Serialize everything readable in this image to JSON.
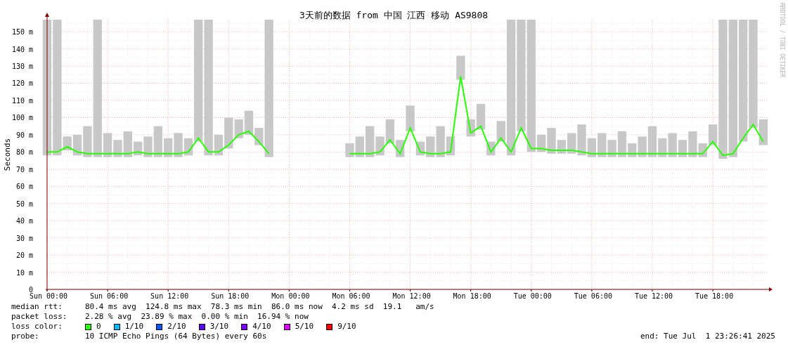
{
  "chart": {
    "credit": "RRDTOOL / TOBI OETIKER",
    "chart_data": {
      "type": "line",
      "grid": true,
      "title": "3天前的数据 from 中国 江西 移动 AS9808",
      "ylabel": "Seconds",
      "ylim": [
        0,
        157
      ],
      "categories": [
        "Sun 00:00",
        null,
        null,
        null,
        null,
        null,
        "Sun 06:00",
        null,
        null,
        null,
        null,
        null,
        "Sun 12:00",
        null,
        null,
        null,
        null,
        null,
        "Sun 18:00",
        null,
        null,
        null,
        null,
        null,
        "Mon 00:00",
        null,
        null,
        null,
        null,
        null,
        "Mon 06:00",
        null,
        null,
        null,
        null,
        null,
        "Mon 12:00",
        null,
        null,
        null,
        null,
        null,
        "Mon 18:00",
        null,
        null,
        null,
        null,
        null,
        "Tue 00:00",
        null,
        null,
        null,
        null,
        null,
        "Tue 06:00",
        null,
        null,
        null,
        null,
        null,
        "Tue 12:00",
        null,
        null,
        null,
        null,
        null,
        "Tue 18:00",
        null,
        null,
        null,
        null,
        null
      ],
      "yticks": [
        {
          "value": 0,
          "label": "0"
        },
        {
          "value": 10,
          "label": "10 m"
        },
        {
          "value": 20,
          "label": "20 m"
        },
        {
          "value": 30,
          "label": "30 m"
        },
        {
          "value": 40,
          "label": "40 m"
        },
        {
          "value": 50,
          "label": "50 m"
        },
        {
          "value": 60,
          "label": "60 m"
        },
        {
          "value": 70,
          "label": "70 m"
        },
        {
          "value": 80,
          "label": "80 m"
        },
        {
          "value": 90,
          "label": "90 m"
        },
        {
          "value": 100,
          "label": "100 m"
        },
        {
          "value": 110,
          "label": "110 m"
        },
        {
          "value": 120,
          "label": "120 m"
        },
        {
          "value": 130,
          "label": "130 m"
        },
        {
          "value": 140,
          "label": "140 m"
        },
        {
          "value": 150,
          "label": "150 m"
        }
      ],
      "series": [
        {
          "color": "#26ff00",
          "values": [
            80,
            80,
            83,
            80,
            79,
            79,
            79,
            79,
            79,
            80,
            79,
            79,
            79,
            79,
            80,
            88,
            80,
            80,
            84,
            90,
            92,
            86,
            79,
            null,
            null,
            null,
            null,
            null,
            null,
            null,
            79,
            79,
            79,
            80,
            87,
            79,
            94,
            80,
            79,
            79,
            80,
            124,
            91,
            95,
            80,
            88,
            80,
            94,
            82,
            82,
            81,
            81,
            81,
            80,
            79,
            79,
            79,
            79,
            79,
            79,
            79,
            79,
            79,
            79,
            79,
            79,
            86,
            78,
            79,
            88,
            96,
            86
          ]
        }
      ]
    }
  },
  "legend": {
    "rows": [
      {
        "label": "median rtt:",
        "text": "80.4 ms avg  124.8 ms max  78.3 ms min  86.0 ms now  4.2 ms sd  19.1   am/s"
      },
      {
        "label": "packet loss:",
        "text": "2.28 % avg  23.89 % max  0.00 % min  16.94 % now"
      }
    ],
    "loss_label": "loss color:",
    "loss_colors": [
      {
        "label": "0",
        "color": "#26ff00"
      },
      {
        "label": "1/10",
        "color": "#00b8ff"
      },
      {
        "label": "2/10",
        "color": "#0059ff"
      },
      {
        "label": "3/10",
        "color": "#5e00ff"
      },
      {
        "label": "4/10",
        "color": "#7e00ff"
      },
      {
        "label": "5/10",
        "color": "#dd00ff"
      },
      {
        "label": "9/10",
        "color": "#ff0000"
      }
    ],
    "probe_label": "probe:",
    "probe": "10 ICMP Echo Pings (64 Bytes) every 60s",
    "end": "end: Tue Jul  1 23:26:41 2025"
  }
}
